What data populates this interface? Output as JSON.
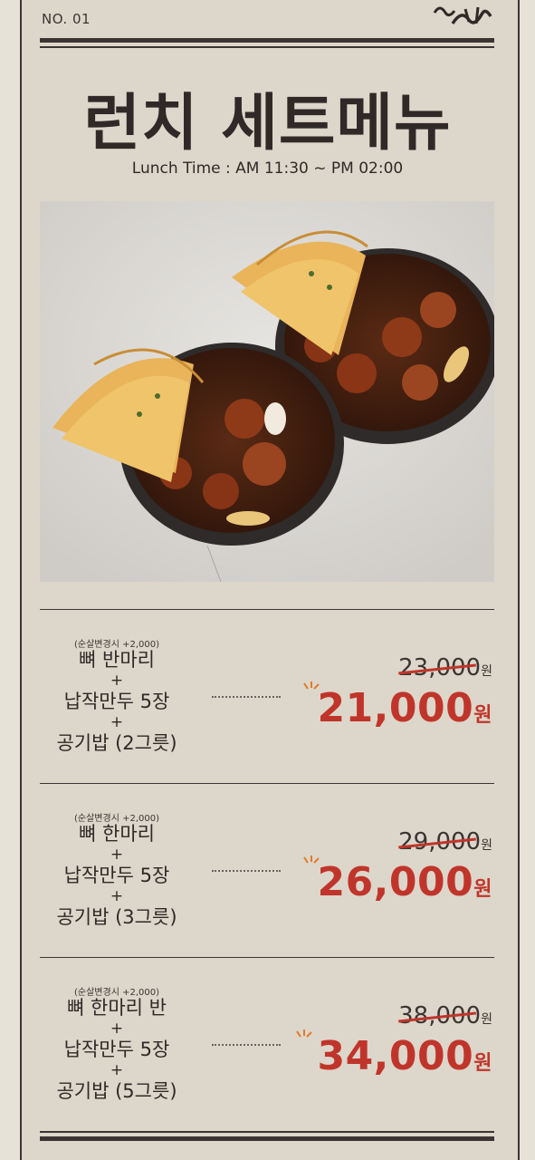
{
  "header": {
    "page_no": "NO. 01",
    "title": "런치 세트메뉴",
    "lunch_time": "Lunch Time : AM 11:30 ~ PM 02:00"
  },
  "colors": {
    "background": "#ddd6ca",
    "text": "#2f2a27",
    "accent_red": "#c0352b"
  },
  "photo": {
    "description_icon": "food-photo-icon"
  },
  "sets": [
    {
      "note": "(순살변경시 +2,000)",
      "line1": "뼈 반마리",
      "plus1": "+",
      "line2": "납작만두 5장",
      "plus2": "+",
      "line3": "공기밥 (2그릇)",
      "old_price": "23,000",
      "new_price": "21,000",
      "currency": "원"
    },
    {
      "note": "(순살변경시 +2,000)",
      "line1": "뼈 한마리",
      "plus1": "+",
      "line2": "납작만두 5장",
      "plus2": "+",
      "line3": "공기밥 (3그릇)",
      "old_price": "29,000",
      "new_price": "26,000",
      "currency": "원"
    },
    {
      "note": "(순살변경시 +2,000)",
      "line1": "뼈 한마리 반",
      "plus1": "+",
      "line2": "납작만두 5장",
      "plus2": "+",
      "line3": "공기밥 (5그릇)",
      "old_price": "38,000",
      "new_price": "34,000",
      "currency": "원"
    }
  ]
}
